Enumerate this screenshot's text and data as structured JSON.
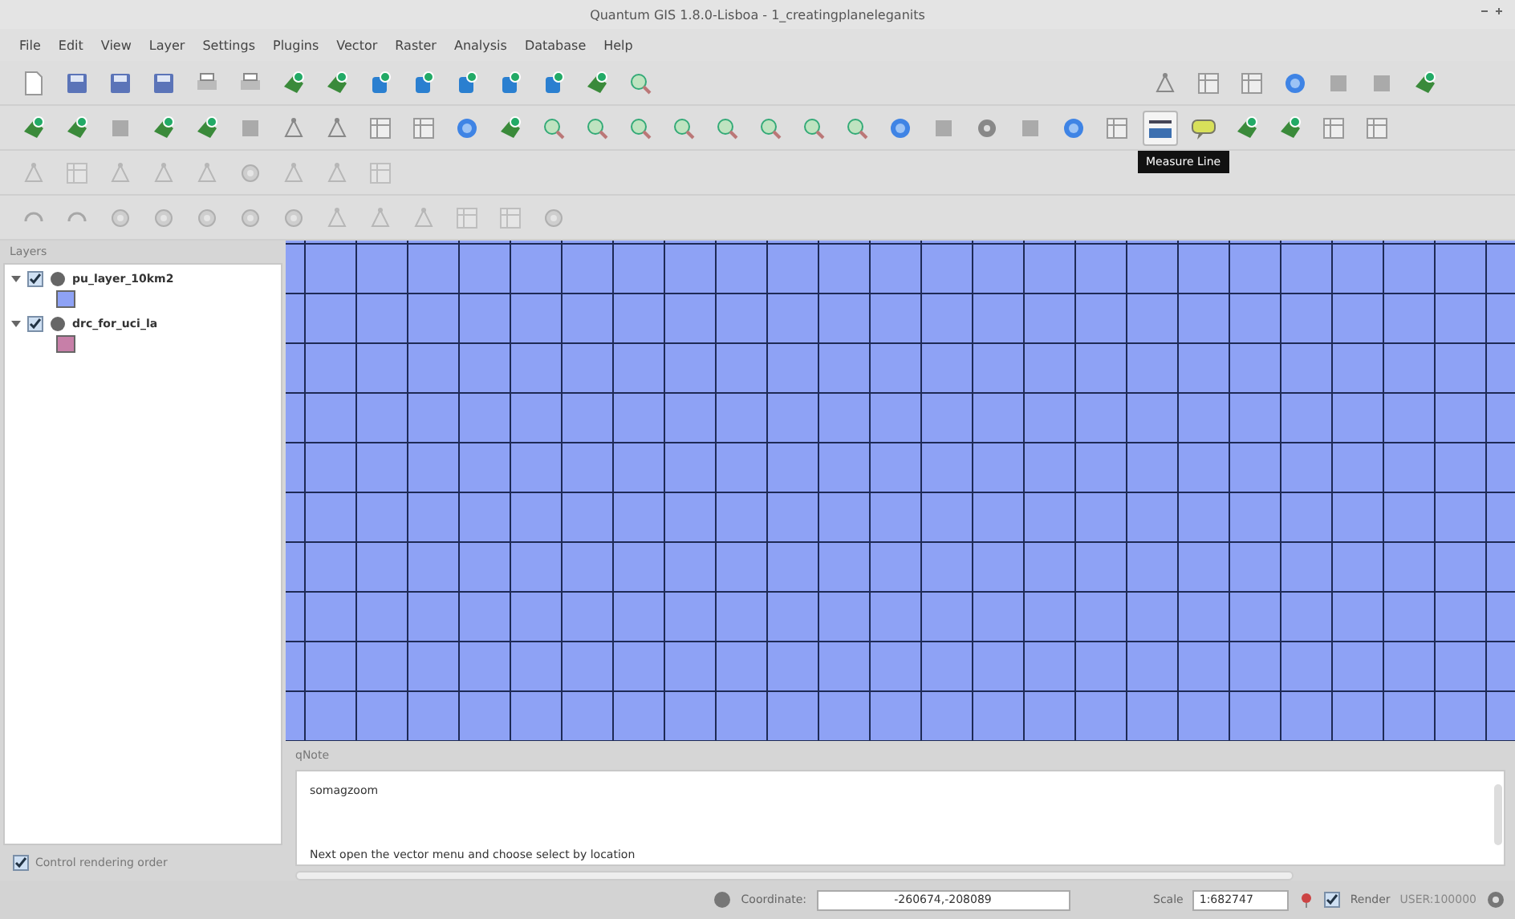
{
  "window": {
    "title": "Quantum GIS 1.8.0-Lisboa - 1_creatingplaneleganits"
  },
  "menu": [
    "File",
    "Edit",
    "View",
    "Layer",
    "Settings",
    "Plugins",
    "Vector",
    "Raster",
    "Analysis",
    "Database",
    "Help"
  ],
  "tooltip": {
    "text": "Measure Line"
  },
  "layers_panel": {
    "title": "Layers",
    "items": [
      {
        "name": "pu_layer_10km2",
        "checked": true,
        "expanded": true,
        "color": "#8ea2f5"
      },
      {
        "name": "drc_for_uci_la",
        "checked": true,
        "expanded": true,
        "color": "#c77fa8"
      }
    ],
    "footer": {
      "label": "Control rendering order",
      "checked": true
    }
  },
  "note_panel": {
    "title": "qNote",
    "lines": [
      "somagzoom",
      "Next open the vector menu and choose select by location"
    ]
  },
  "status_bar": {
    "coordinate_label": "Coordinate:",
    "coordinate": "-260674,-208089",
    "scale_label": "Scale",
    "scale": "1:682747",
    "render": {
      "label": "Render",
      "checked": true
    },
    "crs": "USER:100000"
  }
}
